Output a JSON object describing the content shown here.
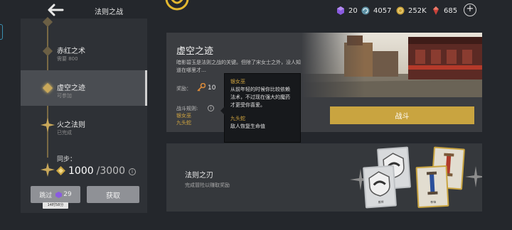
{
  "header": {
    "title": "法则之战",
    "resources": [
      {
        "icon": "purple-gem-icon",
        "value": "20"
      },
      {
        "icon": "swirl-token-icon",
        "value": "4057"
      },
      {
        "icon": "gold-coin-icon",
        "value": "252K"
      },
      {
        "icon": "red-crystal-icon",
        "value": "685"
      }
    ]
  },
  "chapters": [
    {
      "title": "赤红之术",
      "subtitle": "需要 800",
      "state": "locked"
    },
    {
      "title": "虚空之迹",
      "subtitle": "可参加",
      "state": "active"
    },
    {
      "title": "火之法则",
      "subtitle": "已完成",
      "state": "completed"
    }
  ],
  "sync": {
    "label": "同步：",
    "current": "1000",
    "max": "/3000"
  },
  "left_buttons": {
    "skip_label": "跳过",
    "skip_cost": "29",
    "skip_timer": "14时58分",
    "claim_label": "获取"
  },
  "stage": {
    "title": "虚空之迹",
    "description": "暗影碧玉是法则之战的关键。但除了宋女士之外，没人知道在哪里才…",
    "reward_label": "奖励：",
    "reward_value": "10",
    "rules_label": "战斗规则:",
    "rules": [
      "银女巫",
      "九头蛇"
    ],
    "fight_label": "战斗"
  },
  "tooltip": {
    "entries": [
      {
        "name": "银女巫",
        "desc": "从前年轻的时候你比较依赖法术，不过现在强大的魔药才更受你喜爱。"
      },
      {
        "name": "九头蛇",
        "desc": "敌人恢复生命值"
      }
    ]
  },
  "bottom": {
    "title": "法则之刃",
    "subtitle": "完成冒险以赚取奖励",
    "cards": [
      {
        "label": "",
        "style": "silver",
        "icon": "shield-icon"
      },
      {
        "label": "",
        "style": "gold",
        "icon": "scroll-icon"
      },
      {
        "label": "盾牌",
        "style": "silver",
        "icon": "shield-icon"
      },
      {
        "label": "卷轴",
        "style": "gold",
        "icon": "scroll-icon"
      }
    ]
  }
}
